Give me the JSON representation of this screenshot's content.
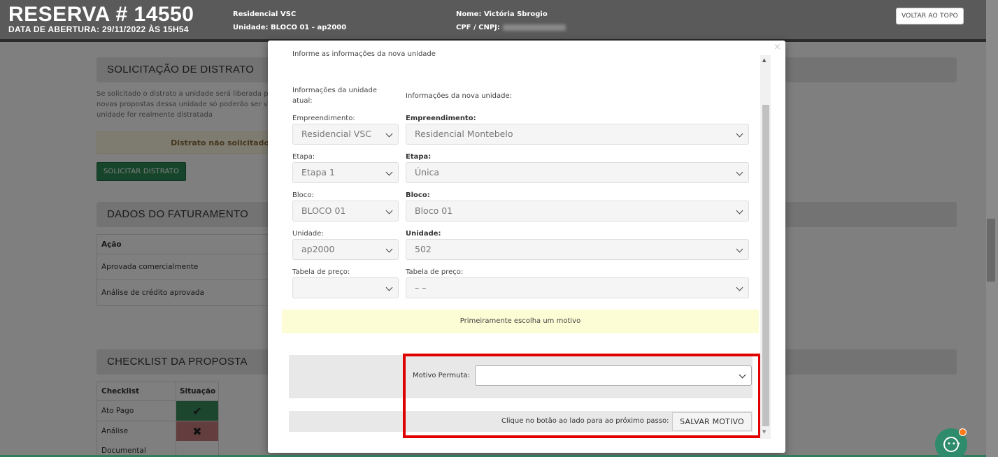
{
  "header": {
    "title": "RESERVA # 14550",
    "subtitle": "DATA DE ABERTURA: 29/11/2022 ÀS 15H54",
    "empreendimento": "Residencial VSC",
    "unidade_label": "Unidade:",
    "unidade_value": "BLOCO 01 - ap2000",
    "nome_label": "Nome:",
    "nome_value": "Victória Sbrogio",
    "cpf_label": "CPF / CNPJ:",
    "back_to_top": "VOLTAR AO TOPO"
  },
  "background": {
    "distrato_title": "SOLICITAÇÃO DE DISTRATO",
    "distrato_text": "Se solicitado o distrato a unidade será liberada p novas propostas dessa unidade só poderão ser v unidade for realmente distratada",
    "distrato_status": "Distrato não solicitado",
    "distrato_button": "SOLICITAR DISTRATO",
    "faturamento_title": "DADOS DO FATURAMENTO",
    "faturamento_header": "Ação",
    "faturamento_rows": [
      "Aprovada comercialmente",
      "Análise de crédito aprovada"
    ],
    "checklist_title": "CHECKLIST DA PROPOSTA",
    "checklist_headers": [
      "Checklist",
      "Situação"
    ],
    "checklist_rows": [
      {
        "label": "Ato Pago",
        "status": "✔",
        "color": "#3a8d5d"
      },
      {
        "label": "Análise Documental",
        "status": "✖",
        "color": "#c97c7c"
      }
    ]
  },
  "modal": {
    "intro": "Informe as informações da nova unidade",
    "col_current": "Informações da unidade atual:",
    "col_new": "Informações da nova unidade:",
    "fields": [
      {
        "label": "Empreendimento:",
        "current": "Residencial VSC",
        "new": "Residencial Montebelo"
      },
      {
        "label": "Etapa:",
        "current": "Etapa 1",
        "new": "Única"
      },
      {
        "label": "Bloco:",
        "current": "BLOCO 01",
        "new": "Bloco 01"
      },
      {
        "label": "Unidade:",
        "current": "ap2000",
        "new": "502"
      },
      {
        "label": "Tabela de preço:",
        "current": "",
        "new": "– –"
      }
    ],
    "warning": "Primeiramente escolha um motivo",
    "motivo_label": "Motivo Permuta:",
    "motivo_value": "",
    "step_text": "Clique no botão ao lado para ao próximo passo:",
    "save_button": "SALVAR MOTIVO",
    "close_symbol": "×"
  },
  "colors": {
    "header_bg": "#3c3c3c",
    "primary_green": "#2e8b57",
    "highlight_red": "#e00000",
    "warning_yellow": "#fdfdd5"
  }
}
